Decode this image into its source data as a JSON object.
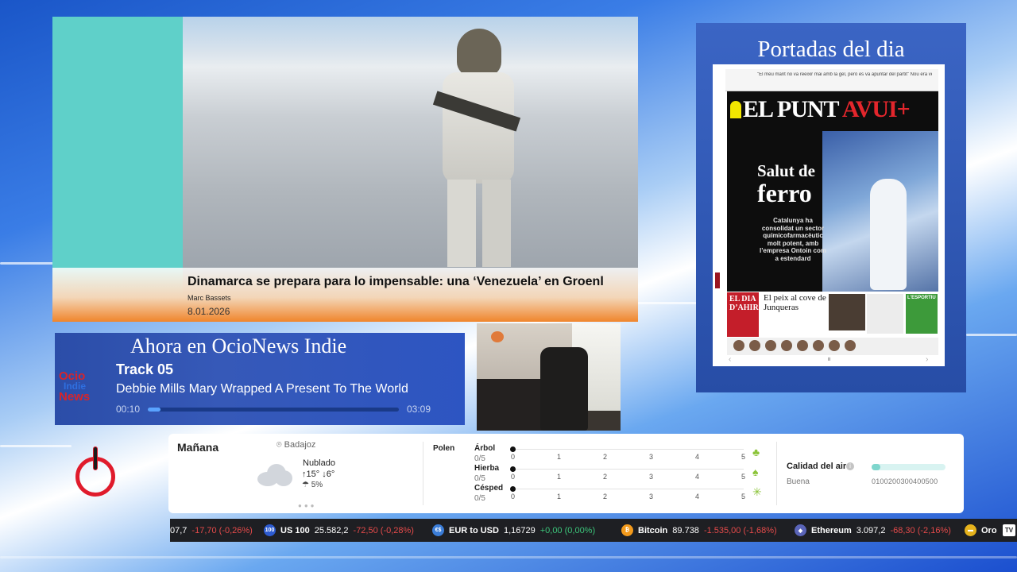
{
  "news": {
    "headline": "Dinamarca se prepara para lo impensable: una ‘Venezuela’ en Groenl",
    "author": "Marc Bassets",
    "date": "8.01.2026"
  },
  "portadas": {
    "title": "Portadas del dia",
    "newspaper": {
      "masthead_a": "EL PUNT",
      "masthead_b": "AVUI",
      "masthead_plus": "+",
      "strip_text": "\"El meu marit no va reeixir mai amb la gel, però es va apuntar del partit\"   Nou era verd de roma a sud",
      "headline_small": "Salut de",
      "headline_big": "ferro",
      "subhead": "Catalunya ha consolidat un sector químicofarmacèutic molt potent, amb l’empresa Ontoin com a estendard",
      "dia_label": "EL DIA D’AHIR",
      "story": "El peix al cove de Junqueras",
      "sports_label": "L'ESPORTIU",
      "nav_prev": "‹",
      "nav_mid": "⏸",
      "nav_next": "›"
    }
  },
  "ahora": {
    "title": "Ahora en OcioNews Indie",
    "logo_line1": "Ocio",
    "logo_line2": "Indie",
    "logo_line3": "News",
    "track": "Track 05",
    "song": "Debbie Mills Mary Wrapped A Present To The World",
    "time_elapsed": "00:10",
    "time_total": "03:09",
    "progress": 0.05
  },
  "weather": {
    "day": "Mañana",
    "location": "Badajoz",
    "condition": "Nublado",
    "temp_max": "15°",
    "temp_min": "6°",
    "precip": "5%",
    "polen_label": "Polen",
    "pollen": [
      {
        "name": "Árbol",
        "value": "0/5",
        "level": 0,
        "icon": "tree-icon"
      },
      {
        "name": "Hierba",
        "value": "0/5",
        "level": 0,
        "icon": "grass-icon"
      },
      {
        "name": "Césped",
        "value": "0/5",
        "level": 0,
        "icon": "lawn-icon"
      }
    ],
    "scale": [
      "0",
      "1",
      "2",
      "3",
      "4",
      "5"
    ],
    "air_quality_label": "Calidad del aire",
    "air_quality_status": "Buena",
    "air_quality_scale": "0100200300400500",
    "air_quality_level": 0.12,
    "colors": {
      "pollen_accent": "#8cc43a",
      "air_fill": "#7fd6cd"
    }
  },
  "ticker": [
    {
      "name": "",
      "value": "07,7",
      "change": "-17,70 (-0,26%)",
      "dir": "neg",
      "icon": "",
      "icon_bg": ""
    },
    {
      "name": "US 100",
      "value": "25.582,2",
      "change": "-72,50 (-0,28%)",
      "dir": "neg",
      "icon": "100",
      "icon_bg": "#2d5bd1"
    },
    {
      "name": "EUR to USD",
      "value": "1,16729",
      "change": "+0,00 (0,00%)",
      "dir": "pos",
      "icon": "€$",
      "icon_bg": "#3b7dd8"
    },
    {
      "name": "Bitcoin",
      "value": "89.738",
      "change": "-1.535,00 (-1,68%)",
      "dir": "neg",
      "icon": "₿",
      "icon_bg": "#f39a1c"
    },
    {
      "name": "Ethereum",
      "value": "3.097,2",
      "change": "-68,30 (-2,16%)",
      "dir": "neg",
      "icon": "◆",
      "icon_bg": "#5a64b8"
    },
    {
      "name": "Oro",
      "value": "",
      "change": "",
      "dir": "neg",
      "icon": "▬",
      "icon_bg": "#e5b21c"
    }
  ],
  "ticker_brand": "TV"
}
